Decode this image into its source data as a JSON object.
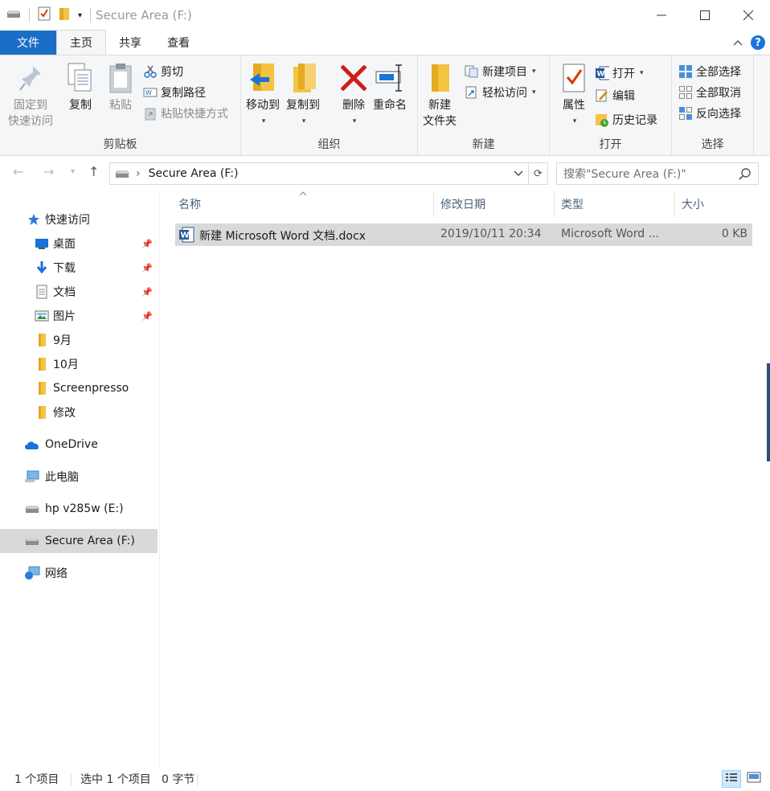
{
  "window": {
    "title": "Secure Area (F:)",
    "controls": {
      "minimize": "—",
      "maximize": "☐",
      "close": "✕"
    }
  },
  "ribbon_tabs": {
    "file": "文件",
    "home": "主页",
    "share": "共享",
    "view": "查看"
  },
  "ribbon": {
    "clipboard": {
      "label": "剪贴板",
      "pin": "固定到\n快速访问",
      "pin_l1": "固定到",
      "pin_l2": "快速访问",
      "copy": "复制",
      "paste": "粘贴",
      "cut": "剪切",
      "copy_path": "复制路径",
      "paste_shortcut": "粘贴快捷方式"
    },
    "organize": {
      "label": "组织",
      "move_to": "移动到",
      "copy_to": "复制到",
      "delete": "删除",
      "rename": "重命名"
    },
    "new": {
      "label": "新建",
      "new_folder_l1": "新建",
      "new_folder_l2": "文件夹",
      "new_item": "新建项目",
      "easy_access": "轻松访问"
    },
    "open": {
      "label": "打开",
      "properties": "属性",
      "open": "打开",
      "edit": "编辑",
      "history": "历史记录"
    },
    "select": {
      "label": "选择",
      "select_all": "全部选择",
      "select_none": "全部取消",
      "invert": "反向选择"
    }
  },
  "address": {
    "path": "Secure Area (F:)",
    "search_placeholder": "搜索\"Secure Area (F:)\""
  },
  "sidebar": {
    "items": [
      {
        "label": "快速访问",
        "icon": "star-icon"
      },
      {
        "label": "桌面",
        "icon": "desktop-icon",
        "pinned": true
      },
      {
        "label": "下载",
        "icon": "download-icon",
        "pinned": true
      },
      {
        "label": "文档",
        "icon": "documents-icon",
        "pinned": true
      },
      {
        "label": "图片",
        "icon": "pictures-icon",
        "pinned": true
      },
      {
        "label": "9月",
        "icon": "folder-icon"
      },
      {
        "label": "10月",
        "icon": "folder-icon"
      },
      {
        "label": "Screenpresso",
        "icon": "folder-icon"
      },
      {
        "label": "修改",
        "icon": "folder-icon"
      },
      {
        "label": "OneDrive",
        "icon": "cloud-icon"
      },
      {
        "label": "此电脑",
        "icon": "computer-icon"
      },
      {
        "label": "hp v285w (E:)",
        "icon": "drive-icon"
      },
      {
        "label": "Secure Area (F:)",
        "icon": "drive-icon",
        "selected": true
      },
      {
        "label": "网络",
        "icon": "network-icon"
      }
    ]
  },
  "columns": {
    "name": "名称",
    "modified": "修改日期",
    "type": "类型",
    "size": "大小"
  },
  "files": [
    {
      "name": "新建 Microsoft Word 文档.docx",
      "modified": "2019/10/11 20:34",
      "type": "Microsoft Word ...",
      "size": "0 KB"
    }
  ],
  "status": {
    "count": "1 个项目",
    "selected": "选中 1 个项目",
    "size": "0 字节"
  },
  "colors": {
    "accent": "#1a6ec5",
    "selection": "#d9d9d9",
    "ribbon_bg": "#f5f6f7"
  }
}
